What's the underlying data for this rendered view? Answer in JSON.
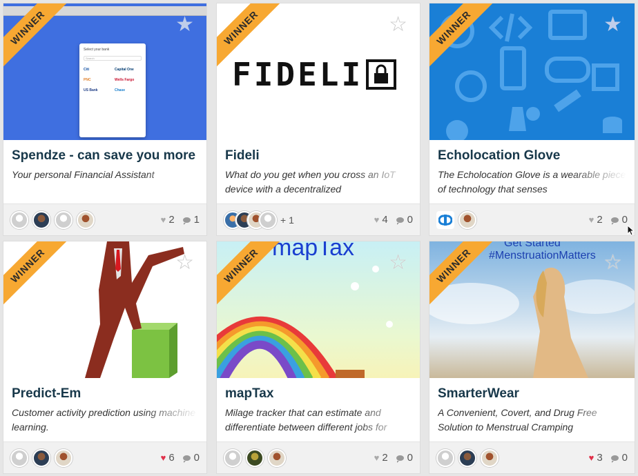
{
  "ribbon_label": "WINNER",
  "cards": [
    {
      "title": "Spendze - can save you more",
      "description": "Your personal Financial Assistant",
      "likes": "2",
      "comments": "1",
      "mock": {
        "header": "Select your bank",
        "search": "Search",
        "banks": [
          "Citi",
          "Capital One",
          "PNC",
          "Wells Fargo",
          "US Bank",
          "Chase"
        ]
      }
    },
    {
      "title": "Fideli",
      "description": "What do you get when you cross an IoT device with a decentralized",
      "likes": "4",
      "comments": "0",
      "logo_text": "FIDELI",
      "extra_members": "+ 1"
    },
    {
      "title": "Echolocation Glove",
      "description": "The Echolocation Glove is a wearable piece of technology that senses",
      "likes": "2",
      "comments": "0"
    },
    {
      "title": "Predict-Em",
      "description": "Customer activity prediction using machine learning.",
      "likes": "6",
      "comments": "0"
    },
    {
      "title": "mapTax",
      "description": "Milage tracker that can estimate and differentiate between different jobs for",
      "likes": "2",
      "comments": "0",
      "banner_text": "mapTax"
    },
    {
      "title": "SmarterWear",
      "description": "A Convenient, Covert, and Drug Free Solution to Menstrual Cramping",
      "likes": "3",
      "comments": "0",
      "banner_line1": "Get Started",
      "banner_line2": "#MenstruationMatters"
    }
  ]
}
